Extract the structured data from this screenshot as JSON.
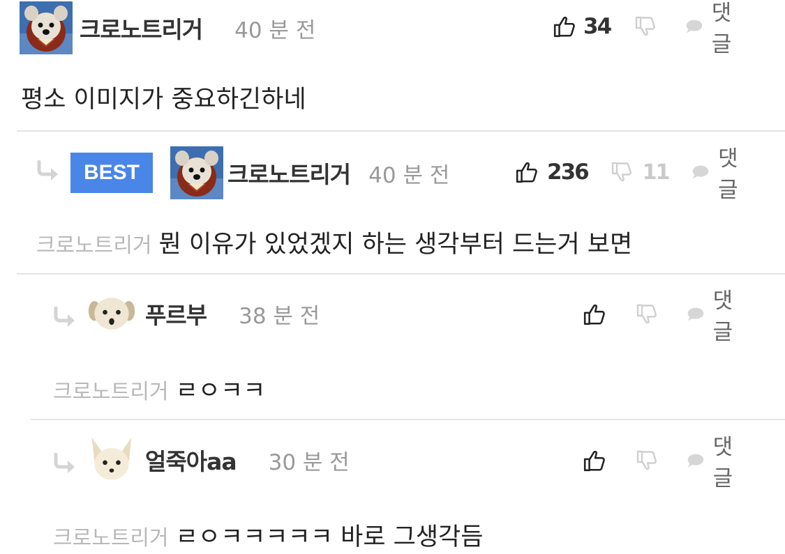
{
  "comments": [
    {
      "author": "크로노트리거",
      "time": "40 분 전",
      "likes": "34",
      "dislikes": "",
      "reply_label": "댓글",
      "mention": "",
      "text": "평소 이미지가 중요하긴하네",
      "best": false
    },
    {
      "author": "크로노트리거",
      "time": "40 분 전",
      "likes": "236",
      "dislikes": "11",
      "reply_label": "댓글",
      "mention": "크로노트리거",
      "text": "뭔 이유가 있었겠지 하는 생각부터 드는거 보면",
      "best": true,
      "badge": "BEST"
    },
    {
      "author": "푸르부",
      "time": "38 분 전",
      "likes": "",
      "dislikes": "",
      "reply_label": "댓글",
      "mention": "크로노트리거",
      "text": "ㄹㅇㅋㅋ",
      "best": false
    },
    {
      "author": "얼죽아aa",
      "time": "30 분 전",
      "likes": "",
      "dislikes": "",
      "reply_label": "댓글",
      "mention": "크로노트리거",
      "text": "ㄹㅇㅋㅋㅋㅋㅋ 바로 그생각듬",
      "best": false
    }
  ],
  "icons": {
    "thumbs_up": "thumbs-up-icon",
    "thumbs_down": "thumbs-down-icon",
    "reply": "speech-bubble-icon",
    "reply_arrow": "reply-arrow-icon"
  },
  "colors": {
    "best_badge": "#4a86e8",
    "muted": "#999999",
    "separator": "#e4e4e4"
  }
}
